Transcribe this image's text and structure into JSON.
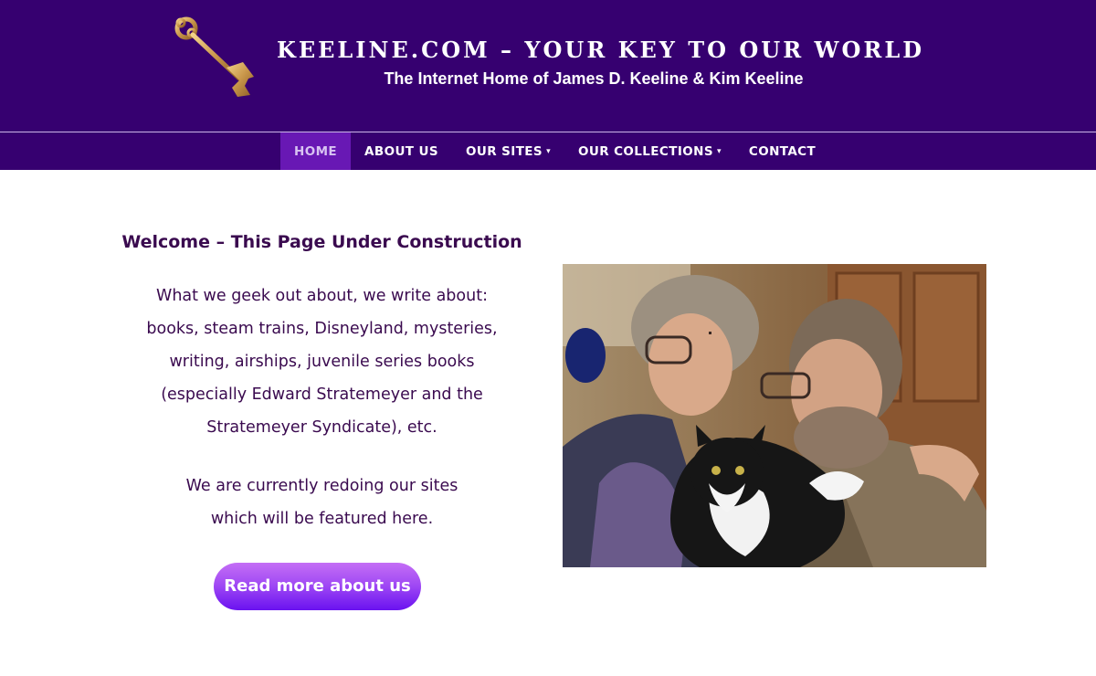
{
  "header": {
    "title": "KEELINE.COM – YOUR KEY TO OUR WORLD",
    "subtitle": "The Internet Home of James D. Keeline & Kim Keeline",
    "logo_icon": "skeleton-key-icon",
    "background": "#360070"
  },
  "nav": {
    "items": [
      {
        "label": "HOME",
        "active": true,
        "dropdown": false
      },
      {
        "label": "ABOUT US",
        "active": false,
        "dropdown": false
      },
      {
        "label": "OUR SITES",
        "active": false,
        "dropdown": true
      },
      {
        "label": "OUR COLLECTIONS",
        "active": false,
        "dropdown": true
      },
      {
        "label": "CONTACT",
        "active": false,
        "dropdown": false
      }
    ],
    "caret": "▾",
    "active_background": "#6818b4"
  },
  "main": {
    "heading": "Welcome – This Page Under Construction",
    "paragraph1_lines": [
      "What we geek out about, we write about:",
      "books, steam trains, Disneyland, mysteries,",
      "writing, airships, juvenile series books",
      "(especially Edward Stratemeyer and the",
      "Stratemeyer Syndicate), etc."
    ],
    "paragraph2_lines": [
      "We are currently redoing our sites",
      "which will be featured here."
    ],
    "button_label": "Read more about us",
    "text_color": "#3a0a4f"
  },
  "photo": {
    "icon": "photo-couple-with-cat"
  }
}
